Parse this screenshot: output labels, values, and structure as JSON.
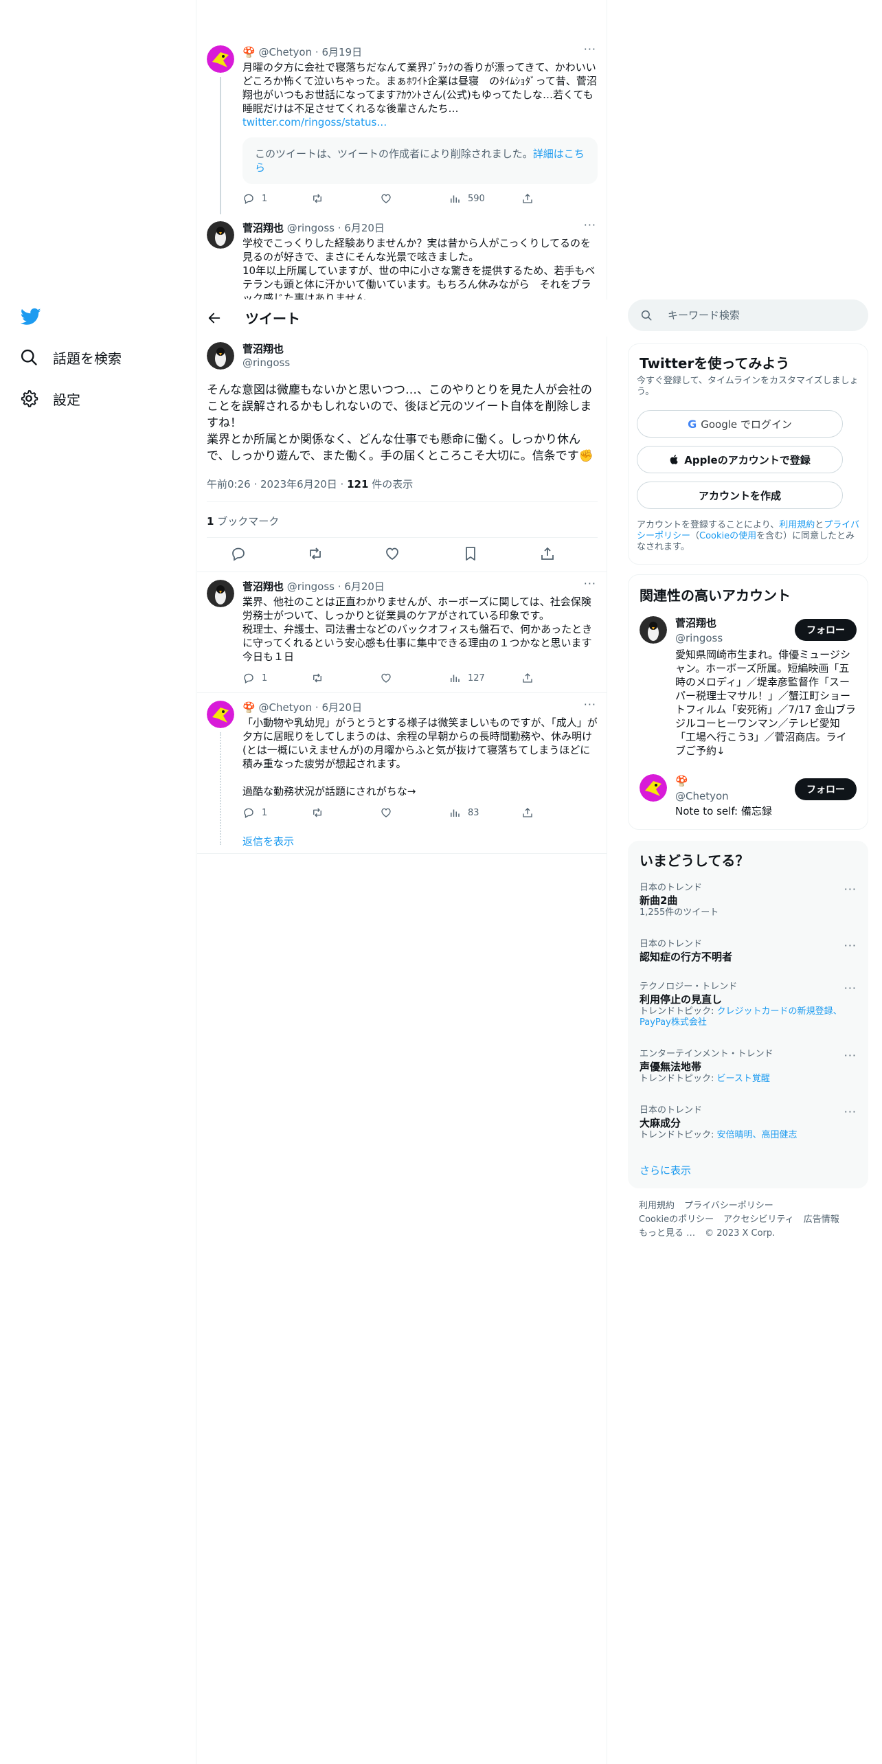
{
  "nav": {
    "logo": "twitter-bird-icon",
    "items": [
      {
        "label": "話題を検索",
        "icon": "search-icon"
      },
      {
        "label": "設定",
        "icon": "gear-icon"
      }
    ]
  },
  "header": {
    "title": "ツイート",
    "back_icon": "arrow-left-icon"
  },
  "thread": [
    {
      "emoji": "🍄",
      "handle": "@Chetyon",
      "date": "6月19日",
      "text": "月曜の夕方に会社で寝落ちだなんて業界ﾌﾞﾗｯｸの香りが漂ってきて、かわいいどころか怖くて泣いちゃった。まぁﾎﾜｲﾄ企業は昼寝　のﾀｲﾑｼｮﾀﾞって昔、菅沼翔也がいつもお世話になってますｱｶｳﾝﾄさん(公式)もゆってたしな…若くても睡眠だけは不足させてくれるな後輩さんたち…",
      "link": "twitter.com/ringoss/status…",
      "deleted_notice": "このツイートは、ツイートの作成者により削除されました。",
      "deleted_link": "詳細はこちら",
      "replies": "1",
      "views": "590"
    },
    {
      "name": "菅沼翔也",
      "handle": "@ringoss",
      "date": "6月20日",
      "text": "学校でこっくりした経験ありませんか？実は昔から人がこっくりしてるのを見るのが好きで、まさにそんな光景で呟きました。\n10年以上所属していますが、世の中に小さな驚きを提供するため、若手もベテランも頭と体に汗かいて働いています。もちろん休みながら　それをブラック感じた事はありません"
    }
  ],
  "focus": {
    "name": "菅沼翔也",
    "handle": "@ringoss",
    "text": "そんな意図は微塵もないかと思いつつ…、このやりとりを見た人が会社のことを誤解されるかもしれないので、後ほど元のツイート自体を削除しますね！\n業界とか所属とか関係なく、どんな仕事でも懸命に働く。しっかり休んで、しっかり遊んで、また働く。手の届くところこそ大切に。信条です✊",
    "time": "午前0:26 · 2023年6月20日 · ",
    "views_count": "121",
    "views_label": " 件の表示",
    "bookmarks_count": "1",
    "bookmarks_label": " ブックマーク"
  },
  "replies": [
    {
      "name": "菅沼翔也",
      "handle": "@ringoss",
      "date": "6月20日",
      "text": "業界、他社のことは正直わかりませんが、ホーボーズに関しては、社会保険労務士がついて、しっかりと従業員のケアがされている印象です。\n税理士、弁護士、司法書士などのバックオフィスも盤石で、何かあったときに守ってくれるという安心感も仕事に集中できる理由の１つかなと思います　今日も１日",
      "replies": "1",
      "views": "127"
    },
    {
      "emoji": "🍄",
      "handle": "@Chetyon",
      "date": "6月20日",
      "text": "「小動物や乳幼児」がうとうとする様子は微笑ましいものですが、「成人」が夕方に居眠りをしてしまうのは、余程の早朝からの長時間勤務や、休み明け(とは一概にいえませんが)の月曜からふと気が抜けて寝落ちてしまうほどに積み重なった疲労が想起されます。\n\n過酷な勤務状況が話題にされがちな→",
      "replies": "1",
      "views": "83"
    }
  ],
  "show_replies": "返信を表示",
  "sidebar": {
    "search_placeholder": "キーワード検索",
    "signup": {
      "title": "Twitterを使ってみよう",
      "subtitle": "今すぐ登録して、タイムラインをカスタマイズしましょう。",
      "google": "Google でログイン",
      "apple": "Appleのアカウントで登録",
      "create": "アカウントを作成",
      "terms_pre": "アカウントを登録することにより、",
      "terms_link": "利用規約",
      "terms_mid": "と",
      "privacy_link": "プライバシーポリシー",
      "cookie_pre": "（",
      "cookie_link": "Cookieの使用",
      "terms_post": "を含む）に同意したとみなされます。"
    },
    "related": {
      "title": "関連性の高いアカウント",
      "accounts": [
        {
          "name": "菅沼翔也",
          "handle": "@ringoss",
          "follow": "フォロー",
          "bio": "愛知県岡崎市生まれ。俳優ミュージシャン。ホーボーズ所属。短編映画「五時のメロディ」／堤幸彦監督作「スーパー税理士マサル！」／蟹江町ショートフィルム「安死術」／7/17 金山ブラジルコーヒーワンマン／テレビ愛知「工場へ行こう3」／菅沼商店。ライブご予約↓"
        },
        {
          "emoji": "🍄",
          "handle": "@Chetyon",
          "follow": "フォロー",
          "bio": "Note to self: 備忘録"
        }
      ]
    },
    "trends": {
      "title": "いまどうしてる？",
      "items": [
        {
          "category": "日本のトレンド",
          "title": "新曲2曲",
          "sub": "1,255件のツイート"
        },
        {
          "category": "日本のトレンド",
          "title": "認知症の行方不明者"
        },
        {
          "category": "テクノロジー・トレンド",
          "title": "利用停止の見直し",
          "sub_pre": "トレンドトピック: ",
          "sub_links": "クレジットカードの新規登録、PayPay株式会社"
        },
        {
          "category": "エンターテインメント・トレンド",
          "title": "声優無法地帯",
          "sub_pre": "トレンドトピック: ",
          "sub_links": "ビースト覚醒"
        },
        {
          "category": "日本のトレンド",
          "title": "大麻成分",
          "sub_pre": "トレンドトピック: ",
          "sub_links": "安倍晴明、高田健志"
        }
      ],
      "show_more": "さらに表示"
    },
    "footer": {
      "links": [
        "利用規約",
        "プライバシーポリシー",
        "Cookieのポリシー",
        "アクセシビリティ",
        "広告情報",
        "もっと見る …"
      ],
      "copyright": "© 2023 X Corp."
    }
  },
  "colors": {
    "accent": "#1d9bf0",
    "text": "#0f1419",
    "muted": "#536471",
    "border": "#eff3f4"
  }
}
